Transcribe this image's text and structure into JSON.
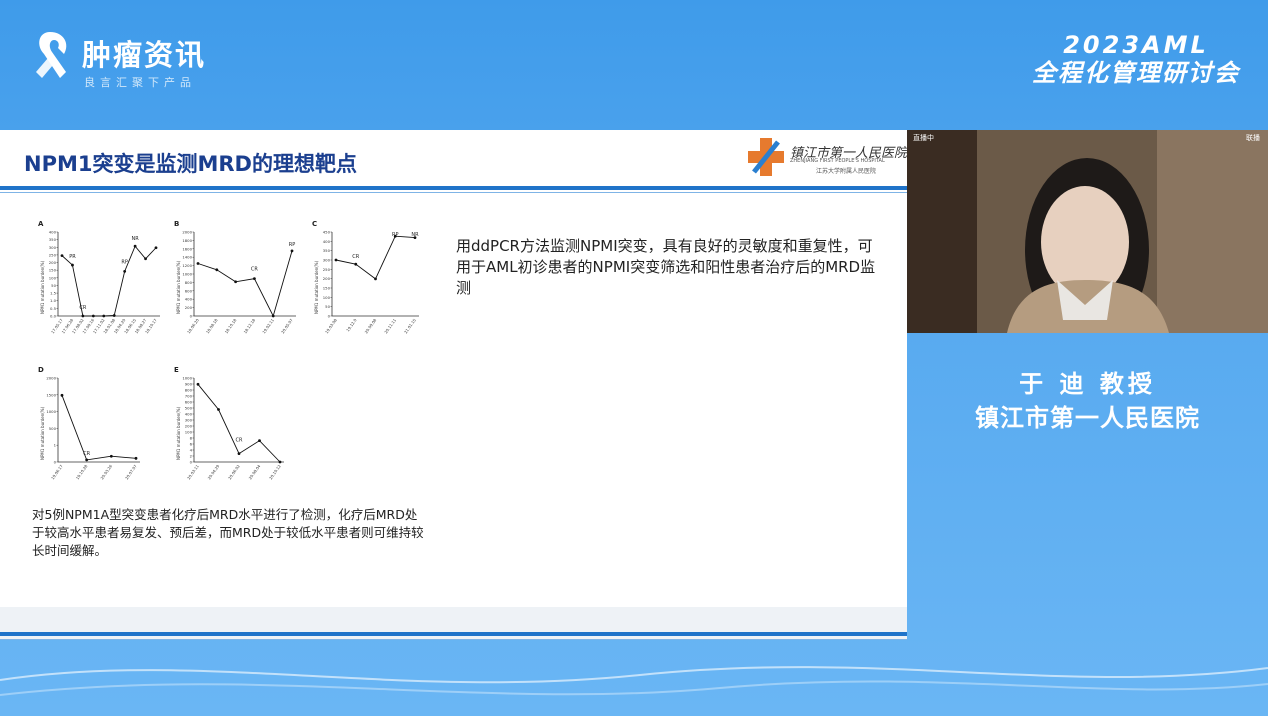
{
  "brand": {
    "name": "肿瘤资讯",
    "tagline": "良言汇聚下产品"
  },
  "event": {
    "line1": "2023AML",
    "line2": "全程化管理研讨会"
  },
  "slide": {
    "title": "NPM1突变是监测MRD的理想靶点",
    "hospital": {
      "name": "镇江市第一人民医院",
      "english": "ZHENJIANG FIRST PEOPLE'S HOSPITAL",
      "subtitle": "江苏大学附属人民医院"
    },
    "right_text": "用ddPCR方法监测NPMI突变，具有良好的灵敏度和重复性，可用于AML初诊患者的NPMI突变筛选和阳性患者治疗后的MRD监测",
    "bottom_text": "对5例NPM1A型突变患者化疗后MRD水平进行了检测，化疗后MRD处于较高水平患者易复发、预后差，而MRD处于较低水平患者则可维持较长时间缓解。"
  },
  "chart_data": [
    {
      "type": "line",
      "panel": "A",
      "ylabel": "NPM1 mutation burden(%)",
      "ylim": [
        0,
        400
      ],
      "yticks": [
        "400",
        "350",
        "300",
        "250",
        "200",
        "150",
        "100",
        "50",
        "1.5",
        "1.0",
        "0.5",
        "0.0"
      ],
      "x": [
        "17.05.17",
        "17.06.28",
        "17.08.02",
        "17.09.16",
        "17.11.02",
        "18.01.08",
        "18.04.20",
        "18.06.15",
        "18.08.27",
        "18.10.17"
      ],
      "values": [
        250,
        190,
        0,
        0,
        0,
        0.05,
        150,
        310,
        230,
        300
      ],
      "annotations": [
        "PR",
        "CR",
        "RP",
        "NR"
      ]
    },
    {
      "type": "line",
      "panel": "B",
      "ylabel": "NPM1 mutation burden(%)",
      "ylim": [
        0,
        2000
      ],
      "yticks": [
        "2000",
        "1800",
        "1600",
        "1400",
        "1200",
        "1000",
        "800",
        "600",
        "400",
        "200",
        "0"
      ],
      "x": [
        "18.06.20",
        "18.08.18",
        "18.10.18",
        "18.12.18",
        "19.02.11",
        "20.05.07"
      ],
      "values": [
        1000,
        800,
        420,
        520,
        0,
        1400
      ],
      "annotations": [
        "CR",
        "RP"
      ]
    },
    {
      "type": "line",
      "panel": "C",
      "ylabel": "NPM1 mutation burden(%)",
      "ylim": [
        0,
        450
      ],
      "yticks": [
        "450",
        "400",
        "350",
        "300",
        "250",
        "200",
        "150",
        "100",
        "50",
        "0"
      ],
      "x": [
        "19.03.08",
        "19.12.0",
        "20.09.08",
        "20.11.11",
        "21.01.15"
      ],
      "values": [
        250,
        220,
        115,
        420,
        410
      ],
      "annotations": [
        "CR",
        "RP",
        "NR"
      ]
    },
    {
      "type": "line",
      "panel": "D",
      "ylabel": "NPM1 mutation burden(%)",
      "ylim": [
        0,
        2000
      ],
      "yticks": [
        "2000",
        "1500",
        "1000",
        "500",
        "1",
        "0"
      ],
      "x": [
        "19.06.17",
        "19.10.28",
        "20.03.26",
        "20.07.07"
      ],
      "values": [
        1450,
        0.2,
        0.55,
        0.35
      ],
      "annotations": [
        "CR"
      ]
    },
    {
      "type": "line",
      "panel": "E",
      "ylabel": "NPM1 mutation burden(%)",
      "ylim": [
        0,
        1000
      ],
      "yticks": [
        "1000",
        "900",
        "800",
        "700",
        "600",
        "500",
        "400",
        "300",
        "200",
        "100",
        "8",
        "6",
        "4",
        "2",
        "0"
      ],
      "x": [
        "20.03.11",
        "20.04.29",
        "20.06.02",
        "20.08.04",
        "20.10.12"
      ],
      "values": [
        900,
        500,
        0.8,
        5.5,
        0
      ],
      "annotations": [
        "CR"
      ]
    }
  ],
  "video": {
    "label_left": "直播中",
    "label_right": "联播"
  },
  "speaker": {
    "name": "于 迪 教授",
    "org": "镇江市第一人民医院"
  },
  "colors": {
    "accent": "#1f73c9",
    "title": "#1b3f8f",
    "background": "#4fa3ee"
  }
}
